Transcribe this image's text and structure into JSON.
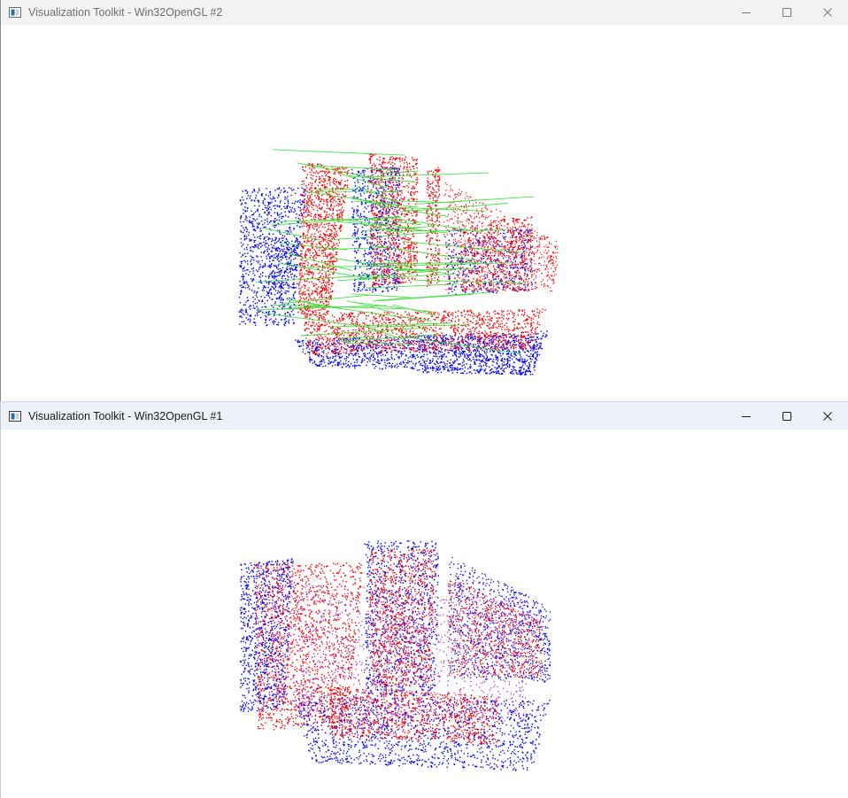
{
  "windows": [
    {
      "id": "win2",
      "title": "Visualization Toolkit - Win32OpenGL #2",
      "icon": "vtk-window-icon",
      "controls": [
        "minimize-icon",
        "maximize-icon",
        "close-icon"
      ],
      "point_cloud_colors": {
        "source": "#ff0000",
        "target": "#0000ff",
        "correspondence": "#33dd33"
      },
      "shows_correspondence_lines": true
    },
    {
      "id": "win1",
      "title": "Visualization Toolkit - Win32OpenGL #1",
      "icon": "vtk-window-icon",
      "controls": [
        "minimize-icon",
        "maximize-icon",
        "close-icon"
      ],
      "point_cloud_colors": {
        "source": "#ff0000",
        "target": "#0000ff",
        "overlap": "#9b19d9"
      },
      "shows_correspondence_lines": false
    }
  ],
  "colors": {
    "inactive_titlebar": "#f3f3f3",
    "active_titlebar": "#eef2f8",
    "viewport_background": "#ffffff"
  }
}
